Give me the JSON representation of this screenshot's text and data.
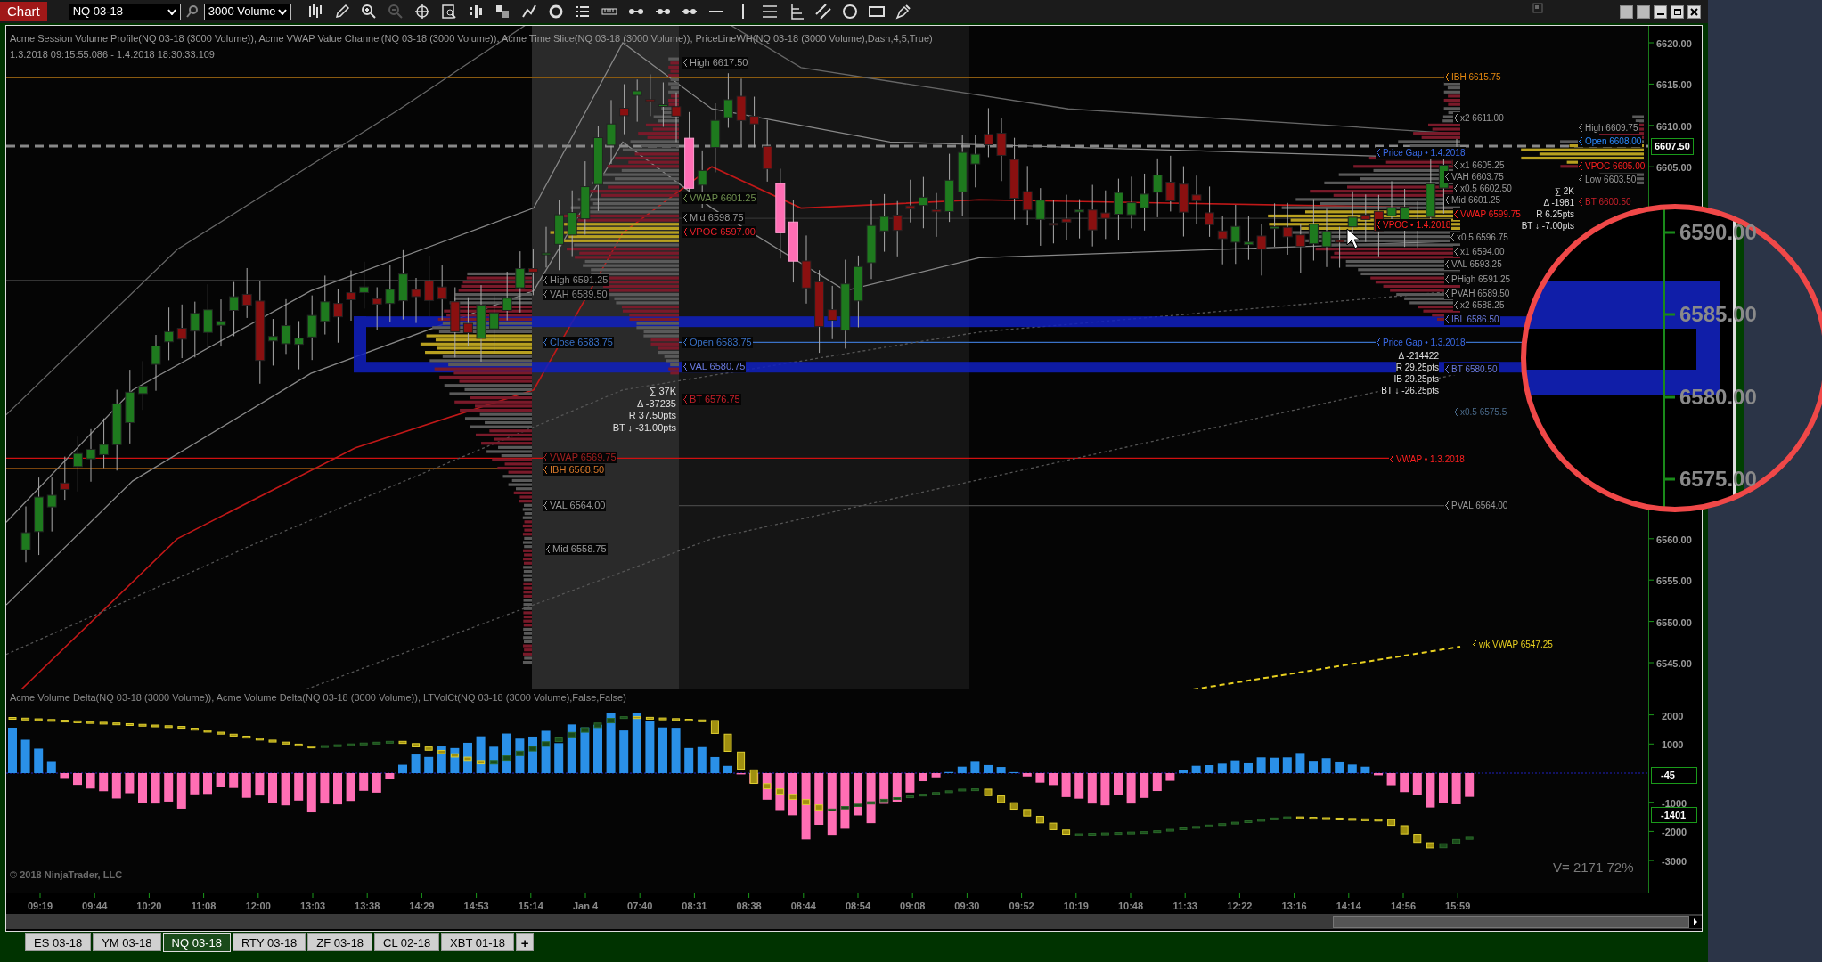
{
  "toolbar": {
    "tab": "Chart",
    "instrument": "NQ 03-18",
    "bar_type": "3000 Volume"
  },
  "price_pane": {
    "title": "Acme Session Volume Profile(NQ 03-18 (3000 Volume)), Acme VWAP Value Channel(NQ 03-18 (3000 Volume)), Acme Time Slice(NQ 03-18 (3000 Volume)), PriceLineWH(NQ 03-18 (3000 Volume),Dash,4,5,True)",
    "date_range": "1.3.2018 09:15:55.086 - 1.4.2018 18:30:33.109",
    "labels": [
      {
        "text": "High 6617.50",
        "color": "#9a9a9a"
      },
      {
        "text": "VWAP 6601.25",
        "color": "#6f8f4f"
      },
      {
        "text": "Mid 6598.75",
        "color": "#9a9a9a"
      },
      {
        "text": "VPOC 6597.00",
        "color": "#e8202a"
      },
      {
        "text": "High 6591.25",
        "color": "#8a8a8a"
      },
      {
        "text": "VAH 6589.50",
        "color": "#8a8a8a"
      },
      {
        "text": "Close 6583.75",
        "color": "#3a72c8"
      },
      {
        "text": "Open 6583.75",
        "color": "#3a72c8"
      },
      {
        "text": "VAL 6580.75",
        "color": "#6a7ae0"
      },
      {
        "text": "BT 6576.75",
        "color": "#c8202a"
      },
      {
        "text": "VWAP 6569.75",
        "color": "#a02020"
      },
      {
        "text": "IBH 6568.50",
        "color": "#d8782a"
      },
      {
        "text": "VAL 6564.00",
        "color": "#9a9a9a"
      },
      {
        "text": "Mid 6558.75",
        "color": "#9a9a9a"
      },
      {
        "text": "IBH 6615.75",
        "color": "#e88a10"
      },
      {
        "text": "x2 6611.00",
        "color": "#9a9a9a"
      },
      {
        "text": "High 6609.75",
        "color": "#9a9a9a"
      },
      {
        "text": "Open 6608.00",
        "color": "#2a8aff"
      },
      {
        "text": "Price Gap • 1.4.2018",
        "color": "#3a6ae8"
      },
      {
        "text": "x1 6605.25",
        "color": "#9a9a9a"
      },
      {
        "text": "VPOC 6605.00",
        "color": "#ff2020"
      },
      {
        "text": "VAH 6603.75",
        "color": "#9a9a9a"
      },
      {
        "text": "Low 6603.50",
        "color": "#9a9a9a"
      },
      {
        "text": "x0.5 6602.50",
        "color": "#9a9a9a"
      },
      {
        "text": "Mid 6601.25",
        "color": "#9a9a9a"
      },
      {
        "text": "BT 6600.50",
        "color": "#c8202a"
      },
      {
        "text": "VWAP 6599.75",
        "color": "#ff2020"
      },
      {
        "text": "VPOC • 1.4.2018",
        "color": "#ff2020"
      },
      {
        "text": "x0.5 6596.75",
        "color": "#9a9a9a"
      },
      {
        "text": "x1 6594.00",
        "color": "#9a9a9a"
      },
      {
        "text": "VAL 6593.25",
        "color": "#9a9a9a"
      },
      {
        "text": "PHigh 6591.25",
        "color": "#9a9a9a"
      },
      {
        "text": "PVAH 6589.50",
        "color": "#9a9a9a"
      },
      {
        "text": "x2 6588.25",
        "color": "#9a9a9a"
      },
      {
        "text": "IBL 6586.50",
        "color": "#6a7ae0"
      },
      {
        "text": "Price Gap • 1.3.2018",
        "color": "#3a6ae8"
      },
      {
        "text": "BT 6580.50",
        "color": "#6a7ae0"
      },
      {
        "text": "x0.5 6575.5",
        "color": "#4a6a8a"
      },
      {
        "text": "VWAP • 1.3.2018",
        "color": "#ff2020"
      },
      {
        "text": "PVAL 6564.00",
        "color": "#9a9a9a"
      },
      {
        "text": "wk VWAP 6547.25",
        "color": "#e8d020"
      }
    ],
    "stats": [
      [
        "∑ 37K",
        "Δ -37235",
        "R 37.50pts",
        "BT ↓ -31.00pts"
      ],
      [
        "∑ 2K",
        "Δ -1981",
        "R 6.25pts",
        "BT ↓ -7.00pts"
      ],
      [
        "Δ -214422",
        "R 29.25pts",
        "IB 29.25pts",
        "BT ↓ -26.25pts"
      ]
    ],
    "axis": [
      "6620.00",
      "6615.00",
      "6610.00",
      "6605.00",
      "6560.00",
      "6555.00",
      "6550.00",
      "6545.00"
    ],
    "current_price": "6607.50"
  },
  "magnifier": {
    "axis": [
      "6590.00",
      "6585.00",
      "6580.00",
      "6575.00"
    ]
  },
  "indicator_pane": {
    "title": "Acme Volume Delta(NQ 03-18 (3000 Volume)), Acme Volume Delta(NQ 03-18 (3000 Volume)), LTVolCt(NQ 03-18 (3000 Volume),False,False)",
    "axis": [
      "2000",
      "1000",
      "-1000",
      "-2000",
      "-3000"
    ],
    "markers": [
      "-45",
      "-1401"
    ],
    "copyright": "© 2018 NinjaTrader, LLC",
    "readout": "V= 2171 72%"
  },
  "time_axis": [
    "09:19",
    "09:44",
    "10:20",
    "11:08",
    "12:00",
    "13:03",
    "13:38",
    "14:29",
    "14:53",
    "15:14",
    "Jan 4",
    "07:40",
    "08:31",
    "08:38",
    "08:44",
    "08:54",
    "09:08",
    "09:30",
    "09:52",
    "10:19",
    "10:48",
    "11:33",
    "12:22",
    "13:16",
    "14:14",
    "14:56",
    "15:59"
  ],
  "instrument_tabs": [
    {
      "label": "ES 03-18",
      "selected": false
    },
    {
      "label": "YM 03-18",
      "selected": false
    },
    {
      "label": "NQ 03-18",
      "selected": true
    },
    {
      "label": "RTY 03-18",
      "selected": false
    },
    {
      "label": "ZF 03-18",
      "selected": false
    },
    {
      "label": "CL 02-18",
      "selected": false
    },
    {
      "label": "XBT 01-18",
      "selected": false
    }
  ],
  "add_tab": "+"
}
